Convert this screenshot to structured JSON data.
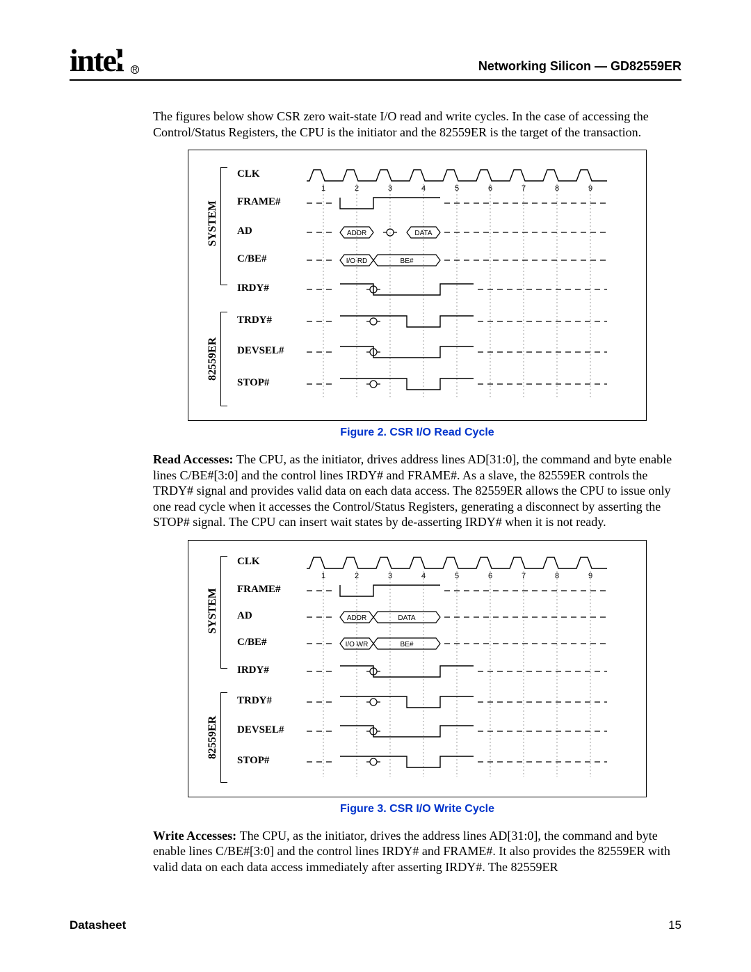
{
  "header": {
    "logo_text": "intel",
    "reg_mark": "R",
    "doc_title": "Networking Silicon — GD82559ER"
  },
  "body": {
    "intro": "The figures below show CSR zero wait-state I/O read and write cycles. In the case of accessing the Control/Status Registers, the CPU is the initiator and the 82559ER is the target of the transaction.",
    "read_para": "The CPU, as the initiator, drives address lines AD[31:0], the command and byte enable lines C/BE#[3:0] and the control lines IRDY# and FRAME#. As a slave, the 82559ER controls the TRDY# signal and provides valid data on each data access. The 82559ER allows the CPU to issue only one read cycle when it accesses the Control/Status Registers, generating a disconnect by asserting the STOP# signal. The CPU can insert wait states by de-asserting IRDY# when it is not ready.",
    "read_lead": "Read Accesses: ",
    "write_para": "The CPU, as the initiator, drives the address lines AD[31:0], the command and byte enable lines C/BE#[3:0] and the control lines IRDY# and FRAME#. It also provides the 82559ER with valid data on each data access immediately after asserting IRDY#. The 82559ER",
    "write_lead": "Write Accesses: "
  },
  "figures": {
    "fig1": {
      "caption": "Figure 2. CSR I/O Read Cycle",
      "group1": "SYSTEM",
      "group2": "82559ER",
      "signals": [
        "CLK",
        "FRAME#",
        "AD",
        "C/BE#",
        "IRDY#",
        "TRDY#",
        "DEVSEL#",
        "STOP#"
      ],
      "clk_count": 9,
      "ad_cells": [
        "ADDR",
        "DATA"
      ],
      "cbe_cells": [
        "I/O RD",
        "BE#"
      ]
    },
    "fig2": {
      "caption": "Figure 3. CSR I/O Write Cycle",
      "group1": "SYSTEM",
      "group2": "82559ER",
      "signals": [
        "CLK",
        "FRAME#",
        "AD",
        "C/BE#",
        "IRDY#",
        "TRDY#",
        "DEVSEL#",
        "STOP#"
      ],
      "clk_count": 9,
      "ad_cells": [
        "ADDR",
        "DATA"
      ],
      "cbe_cells": [
        "I/O WR",
        "BE#"
      ]
    }
  },
  "footer": {
    "left": "Datasheet",
    "right": "15"
  },
  "chart_data": [
    {
      "type": "timing-diagram",
      "title": "Figure 2. CSR I/O Read Cycle",
      "clock_cycles": 9,
      "groups": [
        {
          "name": "SYSTEM",
          "signals": [
            "CLK",
            "FRAME#",
            "AD",
            "C/BE#",
            "IRDY#"
          ]
        },
        {
          "name": "82559ER",
          "signals": [
            "TRDY#",
            "DEVSEL#",
            "STOP#"
          ]
        }
      ],
      "signals": {
        "CLK": {
          "type": "clock",
          "cycles": 9
        },
        "FRAME#": {
          "type": "active-low",
          "float_before": 1,
          "low": [
            1,
            2
          ],
          "high_from": 2,
          "float_after": 4
        },
        "AD": {
          "type": "bus",
          "cells": [
            {
              "start": 1,
              "end": 2,
              "label": "ADDR"
            },
            {
              "start": 3,
              "end": 4,
              "label": "DATA"
            }
          ],
          "turnaround_at": 2.5
        },
        "C/BE#": {
          "type": "bus",
          "cells": [
            {
              "start": 1,
              "end": 2,
              "label": "I/O RD"
            },
            {
              "start": 2,
              "end": 4,
              "label": "BE#"
            }
          ]
        },
        "IRDY#": {
          "type": "active-low",
          "float_before": 1,
          "turnaround_at": 2,
          "low": [
            2,
            4
          ],
          "high_from": 4,
          "float_after": 5
        },
        "TRDY#": {
          "type": "active-low",
          "float_before": 1,
          "turnaround_at": 2,
          "low": [
            3,
            4
          ],
          "high_from": 4,
          "float_after": 5
        },
        "DEVSEL#": {
          "type": "active-low",
          "float_before": 1,
          "turnaround_at": 2,
          "low": [
            2,
            4
          ],
          "high_from": 4,
          "float_after": 5
        },
        "STOP#": {
          "type": "active-low",
          "float_before": 1,
          "turnaround_at": 2,
          "low": [
            3,
            4
          ],
          "high_from": 4,
          "float_after": 5
        }
      }
    },
    {
      "type": "timing-diagram",
      "title": "Figure 3. CSR I/O Write Cycle",
      "clock_cycles": 9,
      "groups": [
        {
          "name": "SYSTEM",
          "signals": [
            "CLK",
            "FRAME#",
            "AD",
            "C/BE#",
            "IRDY#"
          ]
        },
        {
          "name": "82559ER",
          "signals": [
            "TRDY#",
            "DEVSEL#",
            "STOP#"
          ]
        }
      ],
      "signals": {
        "CLK": {
          "type": "clock",
          "cycles": 9
        },
        "FRAME#": {
          "type": "active-low",
          "float_before": 1,
          "low": [
            1,
            2
          ],
          "high_from": 2,
          "float_after": 4
        },
        "AD": {
          "type": "bus",
          "cells": [
            {
              "start": 1,
              "end": 2,
              "label": "ADDR"
            },
            {
              "start": 2,
              "end": 4,
              "label": "DATA"
            }
          ]
        },
        "C/BE#": {
          "type": "bus",
          "cells": [
            {
              "start": 1,
              "end": 2,
              "label": "I/O WR"
            },
            {
              "start": 2,
              "end": 4,
              "label": "BE#"
            }
          ]
        },
        "IRDY#": {
          "type": "active-low",
          "float_before": 1,
          "turnaround_at": 2,
          "low": [
            2,
            4
          ],
          "high_from": 4,
          "float_after": 5
        },
        "TRDY#": {
          "type": "active-low",
          "float_before": 1,
          "turnaround_at": 2,
          "low": [
            3,
            4
          ],
          "high_from": 4,
          "float_after": 5
        },
        "DEVSEL#": {
          "type": "active-low",
          "float_before": 1,
          "turnaround_at": 2,
          "low": [
            2,
            4
          ],
          "high_from": 4,
          "float_after": 5
        },
        "STOP#": {
          "type": "active-low",
          "float_before": 1,
          "turnaround_at": 2,
          "low": [
            3,
            4
          ],
          "high_from": 4,
          "float_after": 5
        }
      }
    }
  ]
}
